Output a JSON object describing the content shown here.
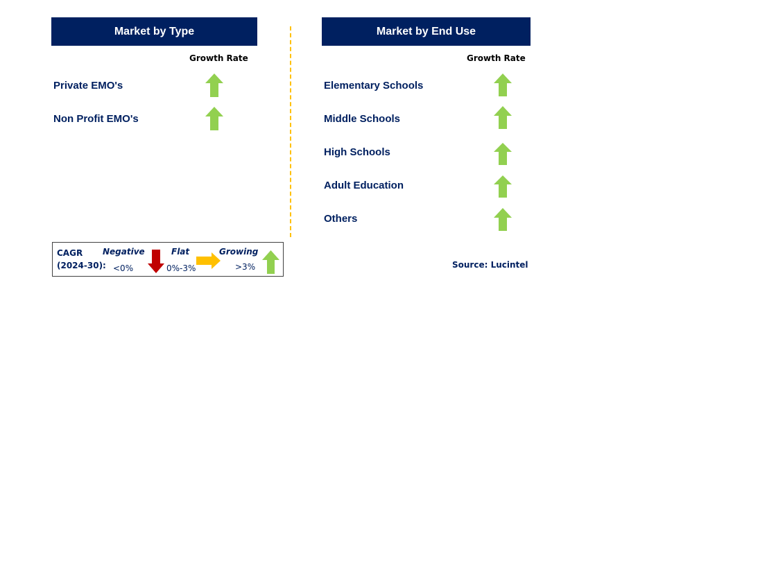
{
  "left_panel": {
    "title": "Market by Type",
    "column_header": "Growth Rate",
    "rows": [
      {
        "label": "Private EMO's",
        "trend": "growing"
      },
      {
        "label": "Non Profit EMO's",
        "trend": "growing"
      }
    ]
  },
  "right_panel": {
    "title": "Market by End Use",
    "column_header": "Growth Rate",
    "rows": [
      {
        "label": "Elementary Schools",
        "trend": "growing"
      },
      {
        "label": "Middle Schools",
        "trend": "growing"
      },
      {
        "label": "High Schools",
        "trend": "growing"
      },
      {
        "label": "Adult Education",
        "trend": "growing"
      },
      {
        "label": "Others",
        "trend": "growing"
      }
    ]
  },
  "legend": {
    "cagr_label": "CAGR",
    "period_label": "(2024-30):",
    "negative": {
      "label": "Negative",
      "range": "<0%",
      "color": "#C00000"
    },
    "flat": {
      "label": "Flat",
      "range": "0%-3%",
      "color": "#FFC000"
    },
    "growing": {
      "label": "Growing",
      "range": ">3%",
      "color": "#92D050"
    }
  },
  "source": "Source: Lucintel",
  "colors": {
    "header_bg": "#002060",
    "divider": "#FFC000",
    "text": "#002060"
  }
}
